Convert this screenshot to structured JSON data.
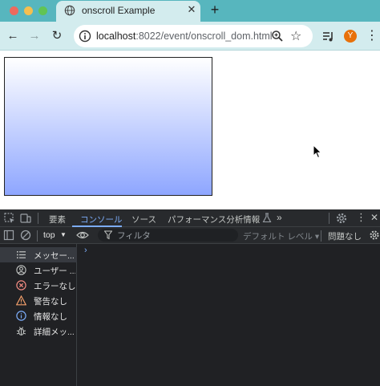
{
  "browser": {
    "tab": {
      "title": "onscroll Example",
      "close_glyph": "✕"
    },
    "new_tab_glyph": "+",
    "nav": {
      "back_glyph": "←",
      "forward_glyph": "→",
      "reload_glyph": "↻"
    },
    "omnibox": {
      "host": "localhost",
      "path": ":8022/event/onscroll_dom.html"
    },
    "star_glyph": "☆",
    "menu_glyph": "⋮",
    "avatar_letter": "Y",
    "colors": {
      "tabstrip": "#57b6be",
      "toolbar": "#d3ecee",
      "avatar": "#e8710a"
    }
  },
  "page": {
    "box_gradient": {
      "top": "#ffffff",
      "bottom": "#8ea6ff"
    }
  },
  "devtools": {
    "tabs": [
      "要素",
      "コンソール",
      "ソース",
      "パフォーマンス分析情報"
    ],
    "active_tab": "コンソール",
    "more_tabs_glyph": "»",
    "context": "top",
    "filter_placeholder": "フィルタ",
    "levels": "デフォルト レベル ▾",
    "issues": "問題なし",
    "prompt_glyph": "›",
    "sidebar": [
      {
        "label": "メッセー...",
        "icon": "list-icon"
      },
      {
        "label": "ユーザー ...",
        "icon": "user-icon"
      },
      {
        "label": "エラーなし",
        "icon": "error-icon"
      },
      {
        "label": "警告なし",
        "icon": "warning-icon"
      },
      {
        "label": "情報なし",
        "icon": "info-icon"
      },
      {
        "label": "詳細メッ...",
        "icon": "bug-icon"
      }
    ]
  }
}
